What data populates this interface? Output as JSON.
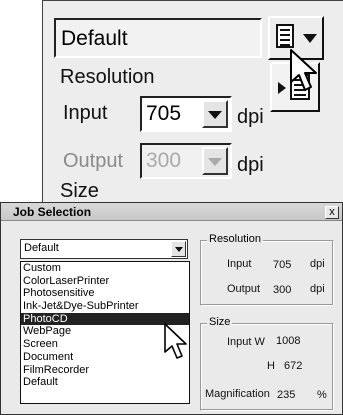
{
  "top_panel": {
    "preset_value": "Default",
    "resolution_label": "Resolution",
    "input_label": "Input",
    "input_value": "705",
    "input_unit": "dpi",
    "output_label": "Output",
    "output_value": "300",
    "output_unit": "dpi",
    "size_label": "Size"
  },
  "dialog": {
    "title": "Job Selection",
    "close_label": "x",
    "selected_job": "Default",
    "jobs": [
      "Custom",
      "ColorLaserPrinter",
      "Photosensitive",
      "Ink-Jet&Dye-SubPrinter",
      "PhotoCD",
      "WebPage",
      "Screen",
      "Document",
      "FilmRecorder",
      "Default"
    ],
    "highlighted_job": "PhotoCD",
    "resolution_group": "Resolution",
    "res_input_label": "Input",
    "res_input_value": "705",
    "res_input_unit": "dpi",
    "res_output_label": "Output",
    "res_output_value": "300",
    "res_output_unit": "dpi",
    "size_group": "Size",
    "size_input_w_label": "Input W",
    "size_input_w_value": "1008",
    "size_h_label": "H",
    "size_h_value": "672",
    "magnification_label": "Magnification",
    "magnification_value": "235",
    "magnification_unit": "%"
  }
}
